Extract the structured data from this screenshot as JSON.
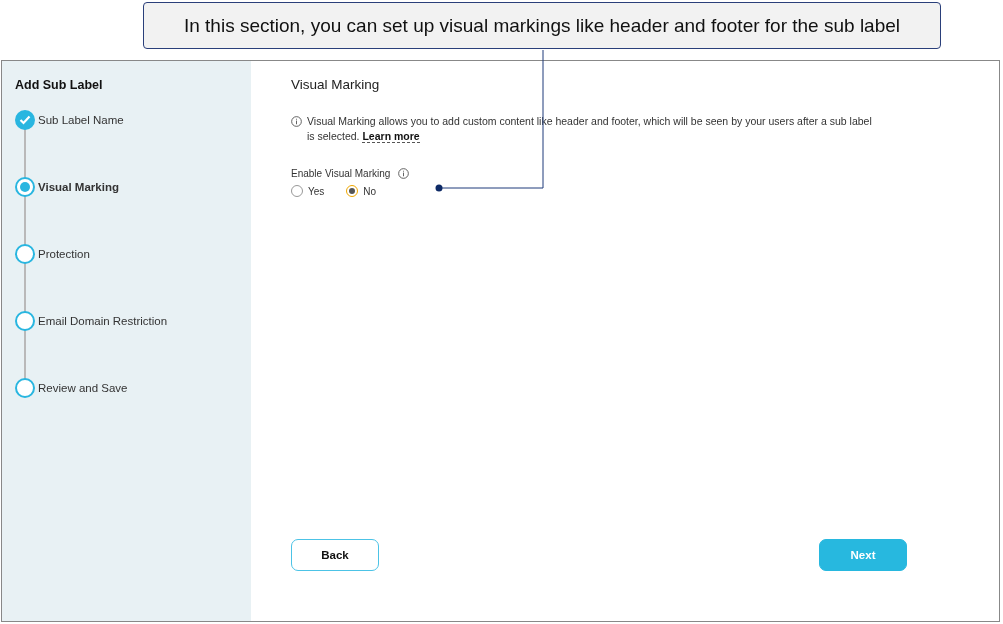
{
  "callout": {
    "text": "In this section, you can set up visual markings like header and footer for the sub label"
  },
  "sidebar": {
    "title": "Add Sub Label",
    "steps": [
      {
        "label": "Sub Label Name",
        "completed": true,
        "selected": false
      },
      {
        "label": "Visual Marking",
        "completed": false,
        "selected": true
      },
      {
        "label": "Protection",
        "completed": false,
        "selected": false
      },
      {
        "label": "Email Domain Restriction",
        "completed": false,
        "selected": false
      },
      {
        "label": "Review and Save",
        "completed": false,
        "selected": false
      }
    ]
  },
  "content": {
    "heading": "Visual Marking",
    "info_text": "Visual Marking allows you to add custom content like header and footer, which will be seen by your users after a sub label is selected.",
    "info_link": "Learn more",
    "field_label": "Enable Visual Marking",
    "options": [
      {
        "label": "Yes",
        "selected": false
      },
      {
        "label": "No",
        "selected": true
      }
    ]
  },
  "buttons": {
    "back": "Back",
    "next": "Next"
  }
}
